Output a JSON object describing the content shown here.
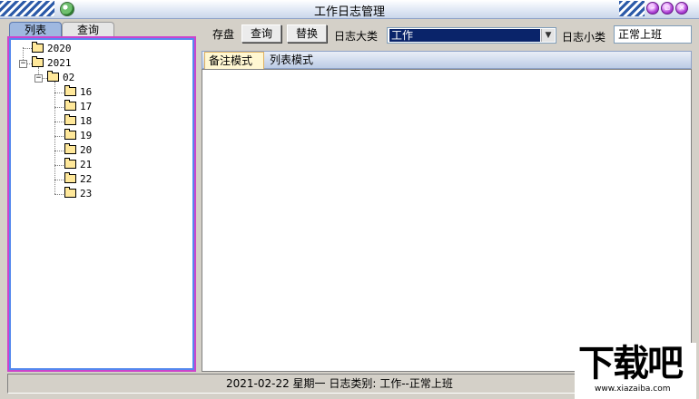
{
  "window": {
    "title": "工作日志管理"
  },
  "left_tabs": [
    {
      "label": "列表"
    },
    {
      "label": "查询"
    }
  ],
  "tree": {
    "years": [
      {
        "label": "2020"
      },
      {
        "label": "2021",
        "months": [
          {
            "label": "02",
            "days": [
              "16",
              "17",
              "18",
              "19",
              "20",
              "21",
              "22",
              "23"
            ]
          }
        ]
      }
    ]
  },
  "toolbar": {
    "save_label": "存盘",
    "query_label": "查询",
    "replace_label": "替换",
    "category_label": "日志大类",
    "category_value": "工作",
    "subcategory_label": "日志小类",
    "subcategory_value": "正常上班"
  },
  "right_tabs": [
    {
      "label": "备注模式",
      "active": true
    },
    {
      "label": "列表模式",
      "active": false
    }
  ],
  "status": {
    "text": "2021-02-22 星期一  日志类别: 工作--正常上班"
  },
  "watermark": {
    "logo_text": "下载吧",
    "url_text": "www.xiazaiba.com"
  },
  "colors": {
    "tree_border": "#cc44cc",
    "tree_inner_border": "#5588ee",
    "selection": "#0a246a",
    "active_tab": "#fff7d2"
  }
}
